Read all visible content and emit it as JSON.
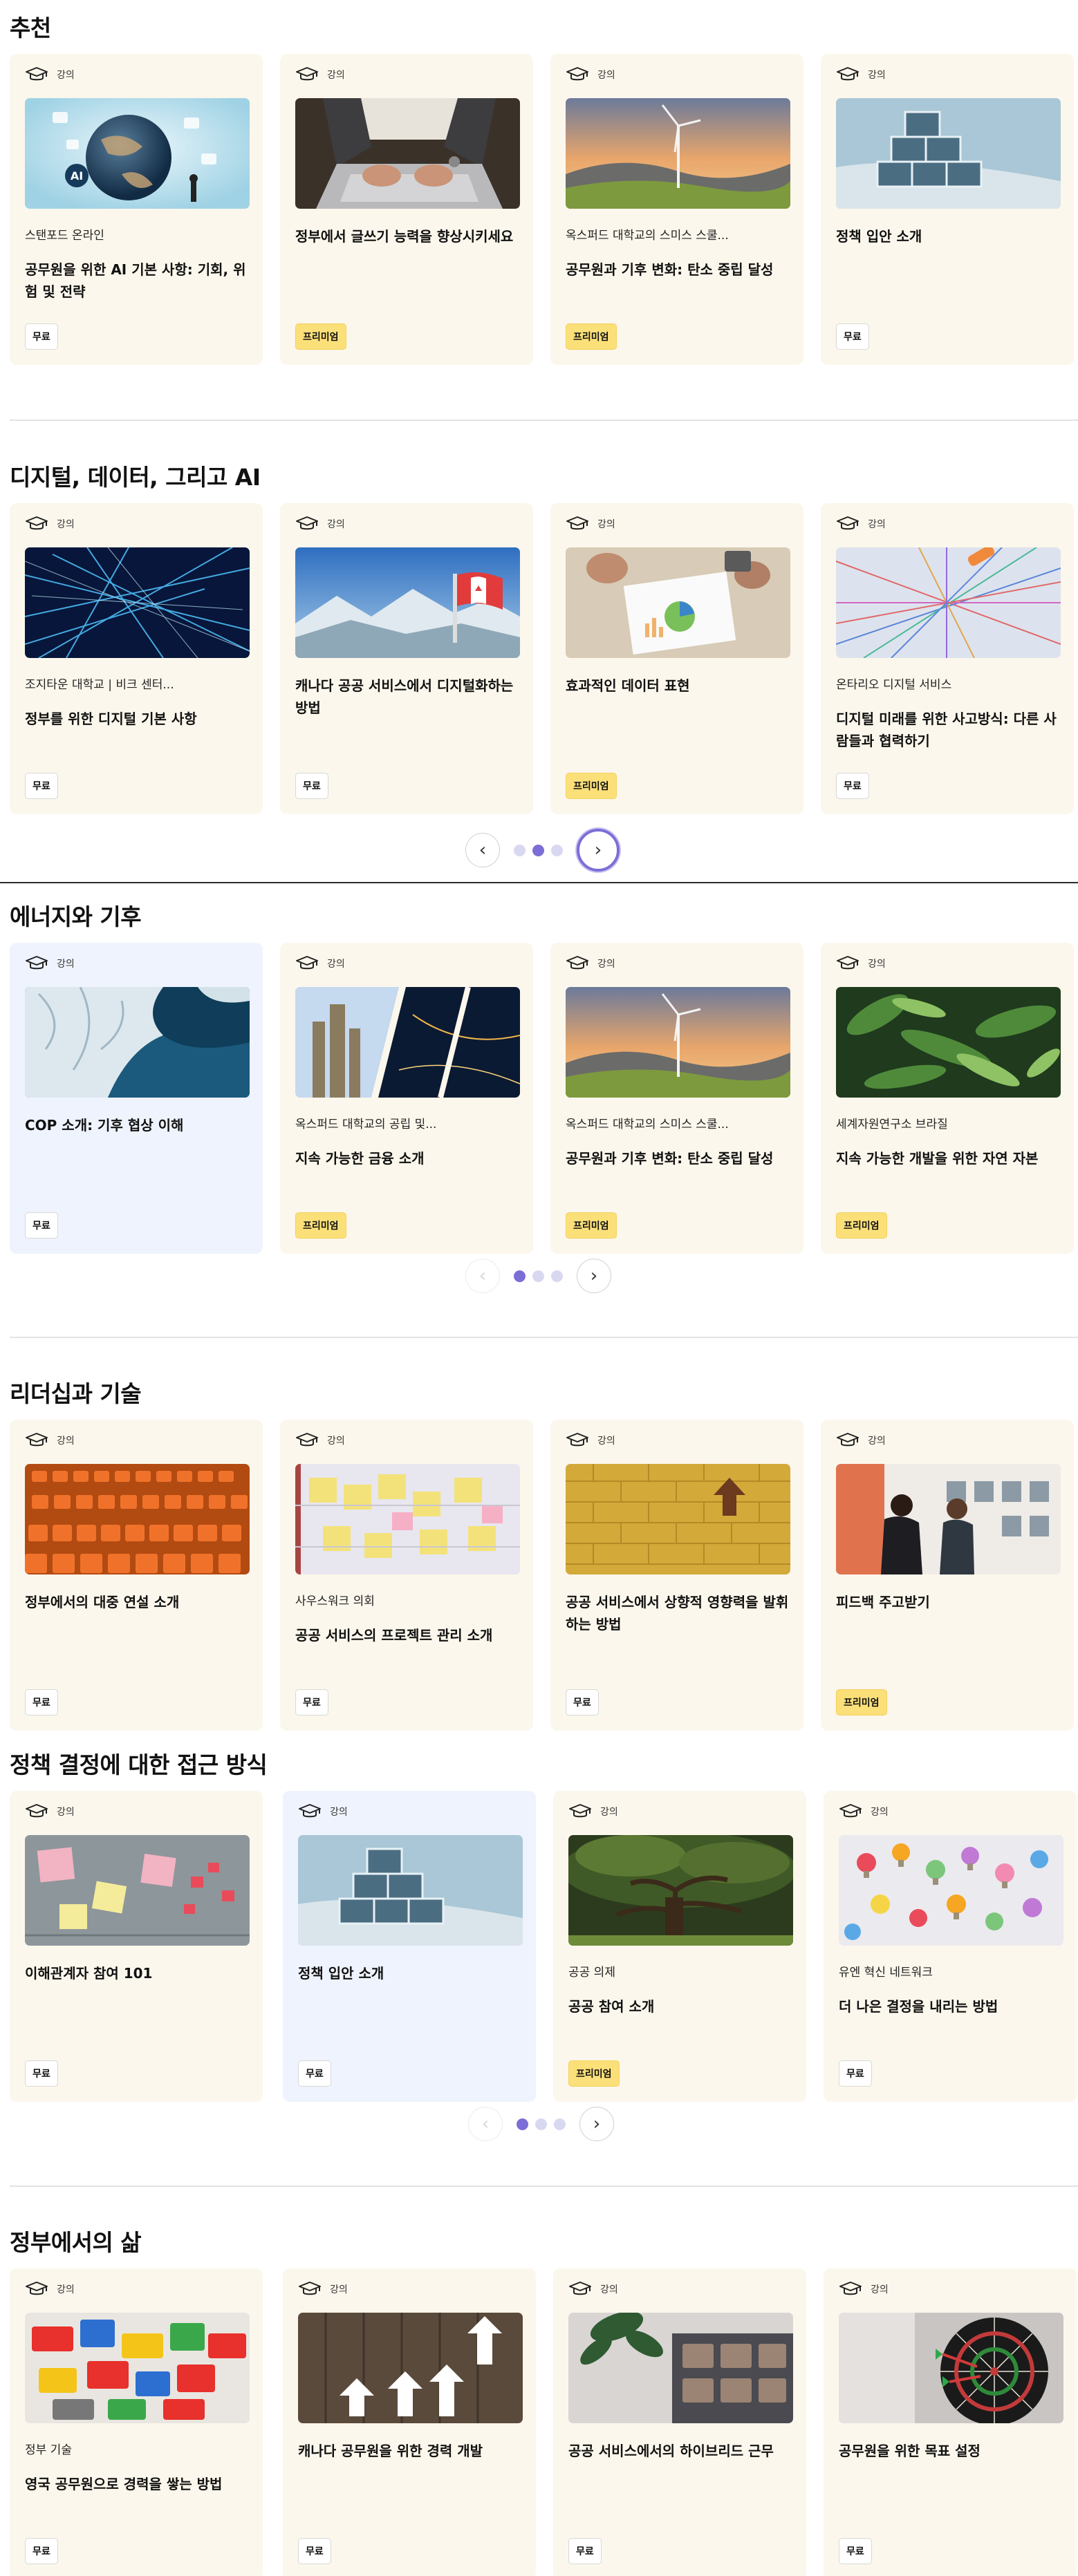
{
  "sections": [
    {
      "title": "추천",
      "cards": [
        {
          "type": "강의",
          "provider": "스탠포드 온라인",
          "title": "공무원을 위한 AI 기본 사항: 기회, 위험 및 전략",
          "badge": "무료"
        },
        {
          "type": "강의",
          "provider": "",
          "title": "정부에서 글쓰기 능력을 향상시키세요",
          "badge": "프리미엄"
        },
        {
          "type": "강의",
          "provider": "옥스퍼드 대학교의 스미스 스쿨...",
          "title": "공무원과 기후 변화: 탄소 중립 달성",
          "badge": "프리미엄"
        },
        {
          "type": "강의",
          "provider": "",
          "title": "정책 입안 소개",
          "badge": "무료"
        }
      ]
    },
    {
      "title": "디지털, 데이터, 그리고 AI",
      "cards": [
        {
          "type": "강의",
          "provider": "조지타운 대학교 | 비크 센터...",
          "title": "정부를 위한 디지털 기본 사항",
          "badge": "무료"
        },
        {
          "type": "강의",
          "provider": "",
          "title": "캐나다 공공 서비스에서 디지털화하는 방법",
          "badge": "무료"
        },
        {
          "type": "강의",
          "provider": "",
          "title": "효과적인 데이터 표현",
          "badge": "프리미엄"
        },
        {
          "type": "강의",
          "provider": "온타리오 디지털 서비스",
          "title": "디지털 미래를 위한 사고방식: 다른 사람들과 협력하기",
          "badge": "무료"
        }
      ],
      "carousel": {
        "prev": "‹",
        "next": "›",
        "active": 1
      }
    },
    {
      "title": "에너지와 기후",
      "cards": [
        {
          "type": "강의",
          "provider": "",
          "title": "COP 소개: 기후 협상 이해",
          "badge": "무료"
        },
        {
          "type": "강의",
          "provider": "옥스퍼드 대학교의 공립 및...",
          "title": "지속 가능한 금융 소개",
          "badge": "프리미엄"
        },
        {
          "type": "강의",
          "provider": "옥스퍼드 대학교의 스미스 스쿨...",
          "title": "공무원과 기후 변화: 탄소 중립 달성",
          "badge": "프리미엄"
        },
        {
          "type": "강의",
          "provider": "세계자원연구소 브라질",
          "title": "지속 가능한 개발을 위한 자연 자본",
          "badge": "프리미엄"
        }
      ],
      "carousel": {
        "prev": "‹",
        "next": "›",
        "active": 0
      }
    },
    {
      "title": "리더십과 기술",
      "cards": [
        {
          "type": "강의",
          "provider": "",
          "title": "정부에서의 대중 연설 소개",
          "badge": "무료"
        },
        {
          "type": "강의",
          "provider": "사우스워크 의회",
          "title": "공공 서비스의 프로젝트 관리 소개",
          "badge": "무료"
        },
        {
          "type": "강의",
          "provider": "",
          "title": "공공 서비스에서 상향적 영향력을 발휘하는 방법",
          "badge": "무료"
        },
        {
          "type": "강의",
          "provider": "",
          "title": "피드백 주고받기",
          "badge": "프리미엄"
        }
      ]
    },
    {
      "title": "정책 결정에 대한 접근 방식",
      "cards": [
        {
          "type": "강의",
          "provider": "",
          "title": "이해관계자 참여 101",
          "badge": "무료"
        },
        {
          "type": "강의",
          "provider": "",
          "title": "정책 입안 소개",
          "badge": "무료"
        },
        {
          "type": "강의",
          "provider": "공공 의제",
          "title": "공공 참여 소개",
          "badge": "프리미엄"
        },
        {
          "type": "강의",
          "provider": "유엔 혁신 네트워크",
          "title": "더 나은 결정을 내리는 방법",
          "badge": "무료"
        }
      ],
      "carousel": {
        "prev": "‹",
        "next": "›",
        "active": 0
      }
    },
    {
      "title": "정부에서의 삶",
      "cards": [
        {
          "type": "강의",
          "provider": "정부 기술",
          "title": "영국 공무원으로 경력을 쌓는 방법",
          "badge": "무료"
        },
        {
          "type": "강의",
          "provider": "",
          "title": "캐나다 공무원을 위한 경력 개발",
          "badge": "무료"
        },
        {
          "type": "강의",
          "provider": "",
          "title": "공공 서비스에서의 하이브리드 근무",
          "badge": "무료"
        },
        {
          "type": "강의",
          "provider": "",
          "title": "공무원을 위한 목표 설정",
          "badge": "무료"
        }
      ]
    }
  ],
  "icons": {
    "card_type_icon": "graduation-cap-icon"
  },
  "colors": {
    "card_bg": "#fcf7ec",
    "card_bg_selected": "#eff3fd",
    "premium_badge": "#fbe079",
    "carousel_accent": "#7b6ed6"
  }
}
